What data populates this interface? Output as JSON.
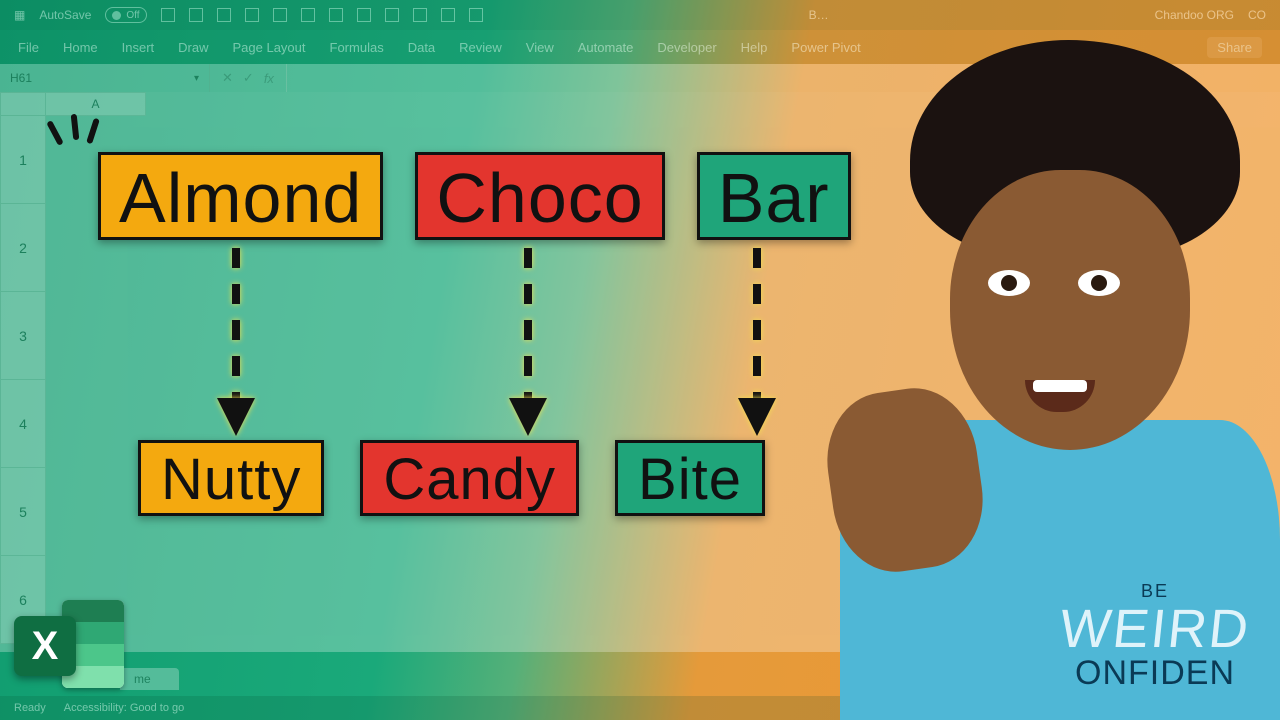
{
  "titlebar": {
    "autosave_label": "AutoSave",
    "autosave_state": "Off",
    "doc_hint": "B…",
    "account": "Chandoo ORG",
    "account_badge": "CO"
  },
  "ribbon": {
    "tabs": [
      "File",
      "Home",
      "Insert",
      "Draw",
      "Page Layout",
      "Formulas",
      "Data",
      "Review",
      "View",
      "Automate",
      "Developer",
      "Help",
      "Power Pivot"
    ],
    "share": "Share"
  },
  "formula": {
    "name_box": "H61",
    "fx_label": "fx"
  },
  "grid": {
    "col": "A",
    "rows": [
      "1",
      "2",
      "3",
      "4",
      "5",
      "6"
    ]
  },
  "sheet_tab": "me",
  "statusbar": {
    "ready": "Ready",
    "accessibility": "Accessibility: Good to go"
  },
  "tiles": {
    "top": [
      {
        "text": "Almond",
        "cls": "orange"
      },
      {
        "text": "Choco",
        "cls": "red"
      },
      {
        "text": "Bar",
        "cls": "green"
      }
    ],
    "bottom": [
      {
        "text": "Nutty",
        "cls": "orange"
      },
      {
        "text": "Candy",
        "cls": "red"
      },
      {
        "text": "Bite",
        "cls": "green"
      }
    ]
  },
  "logo": {
    "letter": "X"
  },
  "shirt": {
    "be": "BE",
    "weird": "WEIRD",
    "conf": "ONFIDEN"
  }
}
